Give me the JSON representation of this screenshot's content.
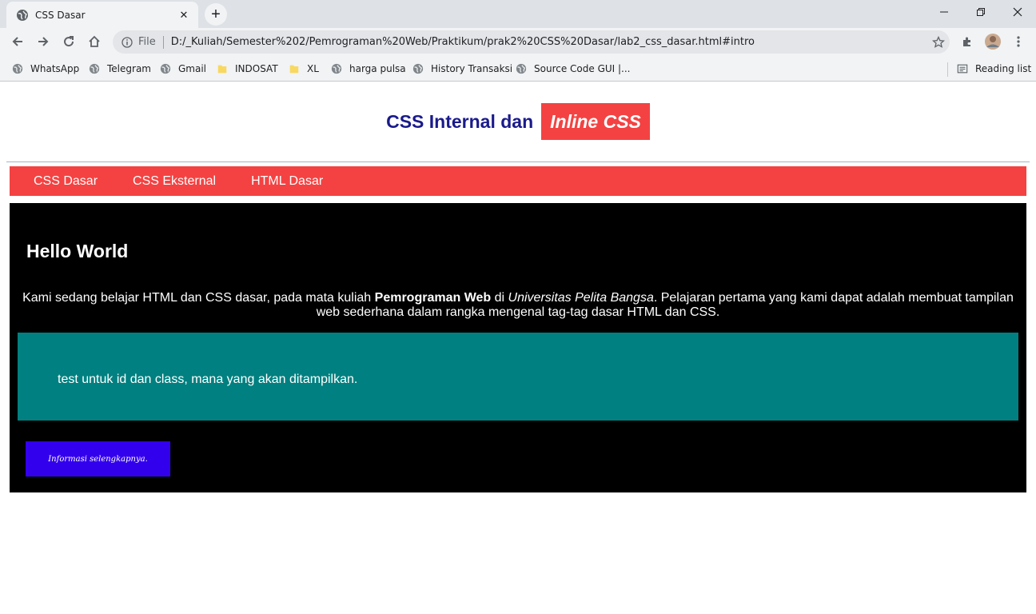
{
  "browser": {
    "tab_title": "CSS Dasar",
    "new_tab": "+",
    "omnibox": {
      "scheme_label": "File",
      "url": "D:/_Kuliah/Semester%202/Pemrograman%20Web/Praktikum/prak2%20CSS%20Dasar/lab2_css_dasar.html#intro"
    },
    "bookmarks": [
      {
        "label": "WhatsApp",
        "icon": "globe-icon"
      },
      {
        "label": "Telegram",
        "icon": "globe-icon"
      },
      {
        "label": "Gmail",
        "icon": "globe-icon"
      },
      {
        "label": "INDOSAT",
        "icon": "folder-icon"
      },
      {
        "label": "XL",
        "icon": "folder-icon"
      },
      {
        "label": "harga pulsa",
        "icon": "globe-icon"
      },
      {
        "label": "History Transaksi",
        "icon": "globe-icon"
      },
      {
        "label": "Source Code GUI |...",
        "icon": "globe-icon"
      }
    ],
    "reading_list": "Reading list"
  },
  "page": {
    "header": {
      "title_part": "CSS Internal dan",
      "title_inline": "Inline CSS"
    },
    "nav": [
      "CSS Dasar",
      "CSS Eksternal",
      "HTML Dasar"
    ],
    "main": {
      "heading": "Hello World",
      "para": {
        "t1": "Kami sedang belajar HTML dan CSS dasar, pada mata kuliah ",
        "bold": "Pemrograman Web",
        "t2": " di ",
        "italic": "Universitas Pelita Bangsa",
        "t3": ". Pelajaran pertama yang kami dapat adalah membuat tampilan web sederhana dalam rangka mengenal tag-tag dasar HTML dan CSS."
      },
      "intro_text": "test untuk id dan class, mana yang akan ditampilkan.",
      "button_label": "Informasi selengkapnya."
    }
  },
  "colors": {
    "nav_bg": "#f44242",
    "main_bg": "#000000",
    "intro_bg": "#008080",
    "button_bg": "#3300ee",
    "title_color": "#1a1a8c"
  }
}
